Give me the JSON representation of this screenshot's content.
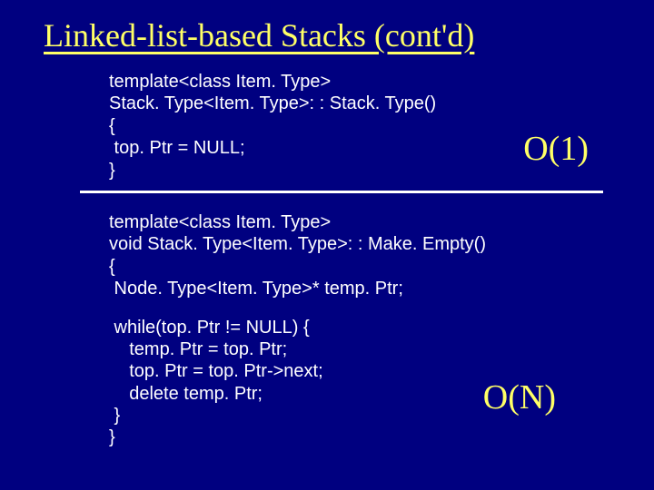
{
  "title": "Linked-list-based Stacks (cont'd)",
  "block1": {
    "l1": "template<class Item. Type>",
    "l2": "Stack. Type<Item. Type>: : Stack. Type()",
    "l3": "{",
    "l4": " top. Ptr = NULL;",
    "l5": "}",
    "complexity": "O(1)"
  },
  "block2": {
    "l1": "template<class Item. Type>",
    "l2": "void Stack. Type<Item. Type>: : Make. Empty()",
    "l3": "{",
    "l4": " Node. Type<Item. Type>* temp. Ptr;",
    "l5": " while(top. Ptr != NULL) {",
    "l6": "    temp. Ptr = top. Ptr;",
    "l7": "    top. Ptr = top. Ptr->next;",
    "l8": "    delete temp. Ptr;",
    "l9": " }",
    "l10": "}",
    "complexity": "O(N)"
  }
}
